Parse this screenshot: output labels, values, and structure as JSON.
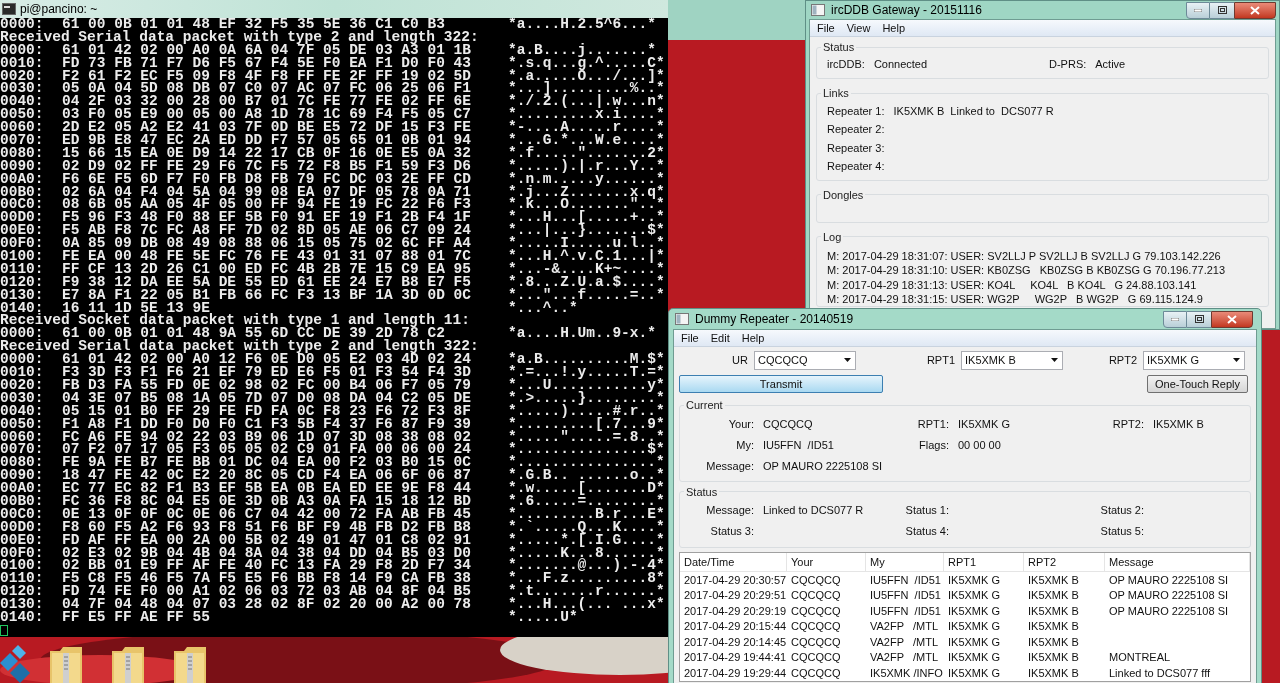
{
  "terminal": {
    "title": "pi@pancino: ~",
    "lines": [
      {
        "kind": "hex",
        "offset": "0000:",
        "bytes": "61 00 0B 01 01 48 EF 32 F5 35 5E 36 C1 C0 B3",
        "ascii": "*a....H.2.5^6...*"
      },
      {
        "kind": "text",
        "text": "Received Serial data packet with type 2 and length 322:"
      },
      {
        "kind": "hex",
        "offset": "0000:",
        "bytes": "61 01 42 02 00 A0 0A 6A 04 7F 05 DE 03 A3 01 1B",
        "ascii": "*a.B....j.......*"
      },
      {
        "kind": "hex",
        "offset": "0010:",
        "bytes": "FD 73 FB 71 F7 D6 F5 67 F4 5E F0 EA F1 D0 F0 43",
        "ascii": "*.s.q...g.^.....C*"
      },
      {
        "kind": "hex",
        "offset": "0020:",
        "bytes": "F2 61 F2 EC F5 09 F8 4F F8 FF FE 2F FF 19 02 5D",
        "ascii": "*.a.....O.../...]*"
      },
      {
        "kind": "hex",
        "offset": "0030:",
        "bytes": "05 0A 04 5D 08 DB 07 C0 07 AC 07 FC 06 25 06 F1",
        "ascii": "*...].........%..*"
      },
      {
        "kind": "hex",
        "offset": "0040:",
        "bytes": "04 2F 03 32 00 28 00 B7 01 7C FE 77 FE 02 FF 6E",
        "ascii": "*./.2.(...|.w...n*"
      },
      {
        "kind": "hex",
        "offset": "0050:",
        "bytes": "03 F0 05 E9 00 05 00 A8 1D 78 1C 69 F4 F5 05 C7",
        "ascii": "*.........x.i....*"
      },
      {
        "kind": "hex",
        "offset": "0060:",
        "bytes": "2D E2 05 A2 E2 41 03 7F 0D BE E5 72 DF 15 F3 FE",
        "ascii": "*-....A.....r....*"
      },
      {
        "kind": "hex",
        "offset": "0070:",
        "bytes": "ED 9B E8 47 EC 2A ED DD F7 57 05 65 01 0B 01 94",
        "ascii": "*...G.*...W.e....*"
      },
      {
        "kind": "hex",
        "offset": "0080:",
        "bytes": "15 66 15 EA 0E D9 14 22 17 CB 0F 16 0E E5 0A 32",
        "ascii": "*.f.....\".......2*"
      },
      {
        "kind": "hex",
        "offset": "0090:",
        "bytes": "02 D9 02 FF FE 29 F6 7C F5 72 F8 B5 F1 59 F3 D6",
        "ascii": "*.....).|.r...Y..*"
      },
      {
        "kind": "hex",
        "offset": "00A0:",
        "bytes": "F6 6E F5 6D F7 F0 FB D8 FB 79 FC DC 03 2E FF CD",
        "ascii": "*.n.m.....y......*"
      },
      {
        "kind": "hex",
        "offset": "00B0:",
        "bytes": "02 6A 04 F4 04 5A 04 99 08 EA 07 DF 05 78 0A 71",
        "ascii": "*.j...Z.......x.q*"
      },
      {
        "kind": "hex",
        "offset": "00C0:",
        "bytes": "08 6B 05 AA 05 4F 05 00 FF 94 FE 19 FC 22 F6 F3",
        "ascii": "*.k...O.......\"..*"
      },
      {
        "kind": "hex",
        "offset": "00D0:",
        "bytes": "F5 96 F3 48 F0 88 EF 5B F0 91 EF 19 F1 2B F4 1F",
        "ascii": "*...H...[.....+..*"
      },
      {
        "kind": "hex",
        "offset": "00E0:",
        "bytes": "F5 AB F8 7C FC A8 FF 7D 02 8D 05 AE 06 C7 09 24",
        "ascii": "*...|...}.......$*"
      },
      {
        "kind": "hex",
        "offset": "00F0:",
        "bytes": "0A 85 09 DB 08 49 08 88 06 15 05 75 02 6C FF A4",
        "ascii": "*.....I.....u.l..*"
      },
      {
        "kind": "hex",
        "offset": "0100:",
        "bytes": "FE EA 00 48 FE 5E FC 76 FE 43 01 31 07 88 01 7C",
        "ascii": "*...H.^.v.C.1...|*"
      },
      {
        "kind": "hex",
        "offset": "0110:",
        "bytes": "FF CF 13 2D 26 C1 00 ED FC 4B 2B 7E 15 C9 EA 95",
        "ascii": "*...-&....K+~....*"
      },
      {
        "kind": "hex",
        "offset": "0120:",
        "bytes": "F9 38 12 DA EE 5A DE 55 ED 61 EE 24 E7 B8 E7 F5",
        "ascii": "*.8...Z.U.a.$....*"
      },
      {
        "kind": "hex",
        "offset": "0130:",
        "bytes": "E7 8A F1 22 05 B1 FB 66 FC F3 13 BF 1A 3D 0D 0C",
        "ascii": "*...\"...f.....=..*"
      },
      {
        "kind": "hex",
        "offset": "0140:",
        "bytes": "16 11 1D 5E 13 9E",
        "ascii": "*...^..*"
      },
      {
        "kind": "text",
        "text": "Received Socket data packet with type 1 and length 11:"
      },
      {
        "kind": "hex",
        "offset": "0000:",
        "bytes": "61 00 0B 01 01 48 9A 55 6D CC DE 39 2D 78 C2",
        "ascii": "*a....H.Um..9-x.*"
      },
      {
        "kind": "text",
        "text": "Received Serial data packet with type 2 and length 322:"
      },
      {
        "kind": "hex",
        "offset": "0000:",
        "bytes": "61 01 42 02 00 A0 12 F6 0E D0 05 E2 03 4D 02 24",
        "ascii": "*a.B..........M.$*"
      },
      {
        "kind": "hex",
        "offset": "0010:",
        "bytes": "F3 3D F3 F1 F6 21 EF 79 ED E6 F5 01 F3 54 F4 3D",
        "ascii": "*.=...!.y.....T.=*"
      },
      {
        "kind": "hex",
        "offset": "0020:",
        "bytes": "FB D3 FA 55 FD 0E 02 98 02 FC 00 B4 06 F7 05 79",
        "ascii": "*...U...........y*"
      },
      {
        "kind": "hex",
        "offset": "0030:",
        "bytes": "04 3E 07 B5 08 1A 05 7D 07 D0 08 DA 04 C2 05 DE",
        "ascii": "*.>.....}........*"
      },
      {
        "kind": "hex",
        "offset": "0040:",
        "bytes": "05 15 01 B0 FF 29 FE FD FA 0C F8 23 F6 72 F3 8F",
        "ascii": "*.....).....#.r..*"
      },
      {
        "kind": "hex",
        "offset": "0050:",
        "bytes": "F1 A8 F1 DD F0 D0 F0 C1 F3 5B F4 37 F6 87 F9 39",
        "ascii": "*.........[.7...9*"
      },
      {
        "kind": "hex",
        "offset": "0060:",
        "bytes": "FC A6 FE 94 02 22 03 B9 06 1D 07 3D 08 38 08 02",
        "ascii": "*.....\".....=.8..*"
      },
      {
        "kind": "hex",
        "offset": "0070:",
        "bytes": "07 F2 07 17 05 F3 05 05 02 C9 01 FA 00 06 00 24",
        "ascii": "*...............$*"
      },
      {
        "kind": "hex",
        "offset": "0080:",
        "bytes": "FE 9A FE B7 FE BB 01 DC 04 EA 00 F2 03 B0 15 0C",
        "ascii": "*................*"
      },
      {
        "kind": "hex",
        "offset": "0090:",
        "bytes": "18 47 FE 42 0C E2 20 8C 05 CD F4 EA 06 6F 06 87",
        "ascii": "*.G.B.. ......o..*"
      },
      {
        "kind": "hex",
        "offset": "00A0:",
        "bytes": "EC 77 EC 82 F1 B3 EF 5B EA 0B EA ED EE 9E F8 44",
        "ascii": "*.w.....[.......D*"
      },
      {
        "kind": "hex",
        "offset": "00B0:",
        "bytes": "FC 36 F8 8C 04 E5 0E 3D 0B A3 0A FA 15 18 12 BD",
        "ascii": "*.6.....=........*"
      },
      {
        "kind": "hex",
        "offset": "00C0:",
        "bytes": "0E 13 0F 0F 0C 0E 06 C7 04 42 00 72 FA AB FB 45",
        "ascii": "*.........B.r...E*"
      },
      {
        "kind": "hex",
        "offset": "00D0:",
        "bytes": "F8 60 F5 A2 F6 93 F8 51 F6 BF F9 4B FB D2 FB B8",
        "ascii": "*.`.....Q...K....*"
      },
      {
        "kind": "hex",
        "offset": "00E0:",
        "bytes": "FD AF FF EA 00 2A 00 5B 02 49 01 47 01 C8 02 91",
        "ascii": "*.....*.[.I.G....*"
      },
      {
        "kind": "hex",
        "offset": "00F0:",
        "bytes": "02 E3 02 9B 04 4B 04 8A 04 38 04 DD 04 B5 03 D0",
        "ascii": "*.....K...8......*"
      },
      {
        "kind": "hex",
        "offset": "0100:",
        "bytes": "02 BB 01 E9 FF AF FE 40 FC 13 FA 29 F8 2D F7 34",
        "ascii": "*.......@...).-.4*"
      },
      {
        "kind": "hex",
        "offset": "0110:",
        "bytes": "F5 C8 F5 46 F5 7A F5 E5 F6 BB F8 14 F9 CA FB 38",
        "ascii": "*...F.z.........8*"
      },
      {
        "kind": "hex",
        "offset": "0120:",
        "bytes": "FD 74 FE F0 00 A1 02 06 03 72 03 AB 04 8F 04 B5",
        "ascii": "*.t.......r......*"
      },
      {
        "kind": "hex",
        "offset": "0130:",
        "bytes": "04 7F 04 48 04 07 03 28 02 8F 02 20 00 A2 00 78",
        "ascii": "*...H...(... ...x*"
      },
      {
        "kind": "hex",
        "offset": "0140:",
        "bytes": "FF E5 FF AE FF 55",
        "ascii": "*.....U*"
      }
    ]
  },
  "gateway": {
    "title": "ircDDB Gateway - 20151116",
    "menu": [
      "File",
      "View",
      "Help"
    ],
    "status": {
      "label": "Status",
      "fields": [
        {
          "label": "ircDDB:",
          "value": "Connected"
        },
        {
          "label": "D-PRS:",
          "value": "Active"
        }
      ]
    },
    "links": {
      "label": "Links",
      "repeaters": [
        {
          "label": "Repeater 1:",
          "value": "IK5XMK B  Linked to  DCS077 R"
        },
        {
          "label": "Repeater 2:"
        },
        {
          "label": "Repeater 3:"
        },
        {
          "label": "Repeater 4:"
        }
      ]
    },
    "dongles": {
      "label": "Dongles"
    },
    "log": {
      "label": "Log",
      "lines": [
        "M: 2017-04-29 18:31:07: USER: SV2LLJ P SV2LLJ B SV2LLJ G 79.103.142.226",
        "M: 2017-04-29 18:31:10: USER: KB0ZSG   KB0ZSG B KB0ZSG G 70.196.77.213",
        "M: 2017-04-29 18:31:13: USER: KO4L     KO4L   B KO4L   G 24.88.103.141",
        "M: 2017-04-29 18:31:15: USER: WG2P     WG2P   B WG2P   G 69.115.124.9"
      ]
    }
  },
  "repeater": {
    "title": "Dummy Repeater - 20140519",
    "menu": [
      "File",
      "Edit",
      "Help"
    ],
    "selectors": [
      {
        "label": "UR",
        "value": "CQCQCQ"
      },
      {
        "label": "RPT1",
        "value": "IK5XMK B"
      },
      {
        "label": "RPT2",
        "value": "IK5XMK G"
      }
    ],
    "transmit": "Transmit",
    "reply": "One-Touch Reply",
    "current": {
      "label": "Current",
      "rows": [
        [
          {
            "label": "Your:",
            "value": "CQCQCQ"
          },
          {
            "label": "RPT1:",
            "value": "IK5XMK G"
          },
          {
            "label": "RPT2:",
            "value": "IK5XMK B"
          }
        ],
        [
          {
            "label": "My:",
            "value": "IU5FFN  /ID51"
          },
          {
            "label": "Flags:",
            "value": "00 00 00"
          }
        ],
        [
          {
            "label": "Message:",
            "value": "OP MAURO 2225108 SI"
          }
        ]
      ]
    },
    "status": {
      "label": "Status",
      "rows": [
        [
          {
            "label": "Message:",
            "value": "Linked to DCS077 R"
          },
          {
            "label": "Status 1:"
          },
          {
            "label": "Status 2:"
          }
        ],
        [
          {
            "label": "Status 3:"
          },
          {
            "label": "Status 4:"
          },
          {
            "label": "Status 5:"
          }
        ]
      ]
    },
    "table": {
      "columns": [
        "Date/Time",
        "Your",
        "My",
        "RPT1",
        "RPT2",
        "Message"
      ],
      "rows": [
        {
          "datetime": "2017-04-29 20:30:57",
          "your": "CQCQCQ",
          "my": "IU5FFN  /ID51",
          "rpt1": "IK5XMK G",
          "rpt2": "IK5XMK B",
          "message": "OP MAURO 2225108 SI"
        },
        {
          "datetime": "2017-04-29 20:29:51",
          "your": "CQCQCQ",
          "my": "IU5FFN  /ID51",
          "rpt1": "IK5XMK G",
          "rpt2": "IK5XMK B",
          "message": "OP MAURO 2225108 SI"
        },
        {
          "datetime": "2017-04-29 20:29:19",
          "your": "CQCQCQ",
          "my": "IU5FFN  /ID51",
          "rpt1": "IK5XMK G",
          "rpt2": "IK5XMK B",
          "message": "OP MAURO 2225108 SI"
        },
        {
          "datetime": "2017-04-29 20:15:44",
          "your": "CQCQCQ",
          "my": "VA2FP   /MTL",
          "rpt1": "IK5XMK G",
          "rpt2": "IK5XMK B"
        },
        {
          "datetime": "2017-04-29 20:14:45",
          "your": "CQCQCQ",
          "my": "VA2FP   /MTL",
          "rpt1": "IK5XMK G",
          "rpt2": "IK5XMK B"
        },
        {
          "datetime": "2017-04-29 19:44:41",
          "your": "CQCQCQ",
          "my": "VA2FP   /MTL",
          "rpt1": "IK5XMK G",
          "rpt2": "IK5XMK B",
          "message": "MONTREAL"
        },
        {
          "datetime": "2017-04-29 19:29:44",
          "your": "CQCQCQ",
          "my": "IK5XMK /INFO",
          "rpt1": "IK5XMK G",
          "rpt2": "IK5XMK B",
          "message": "Linked to DCS077 fff"
        }
      ]
    }
  }
}
